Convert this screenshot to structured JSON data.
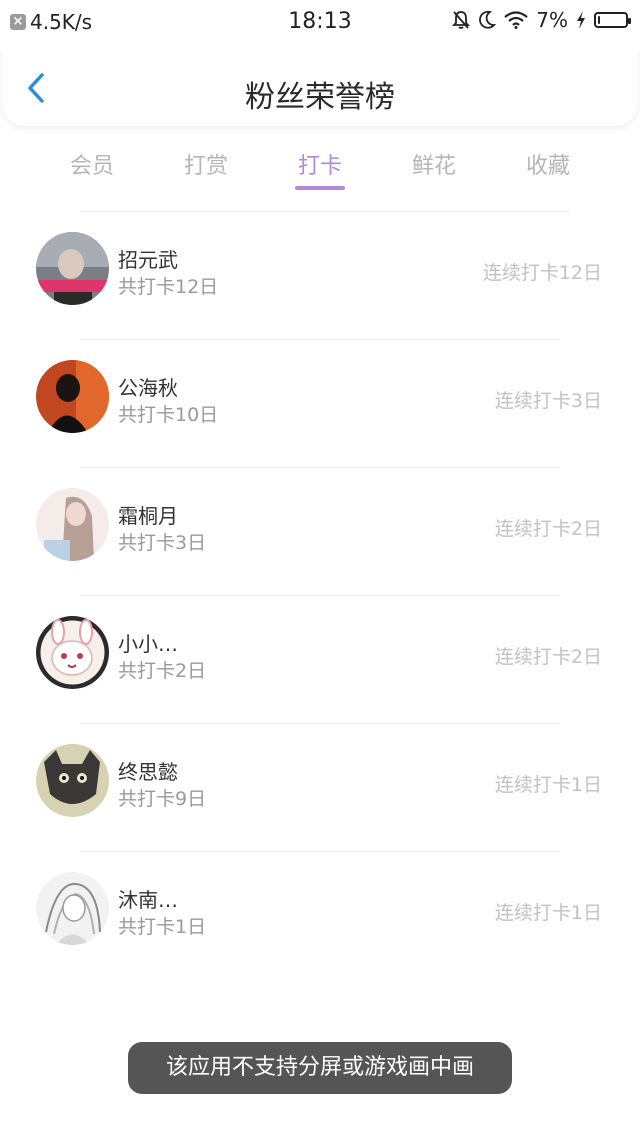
{
  "status_bar": {
    "speed": "4.5K/s",
    "time": "18:13",
    "battery": "7%",
    "battery_level": 0.07,
    "icons": [
      "notification-off-icon",
      "moon-icon",
      "wifi-icon",
      "charging-icon",
      "battery-icon"
    ]
  },
  "nav": {
    "title": "粉丝荣誉榜",
    "back_icon": "chevron-left-icon"
  },
  "tabs": [
    {
      "label": "会员",
      "active": false
    },
    {
      "label": "打赏",
      "active": false
    },
    {
      "label": "打卡",
      "active": true
    },
    {
      "label": "鲜花",
      "active": false
    },
    {
      "label": "收藏",
      "active": false
    }
  ],
  "fans": [
    {
      "name": "招元武",
      "total": "共打卡12日",
      "streak": "连续打卡12日"
    },
    {
      "name": "公海秋",
      "total": "共打卡10日",
      "streak": "连续打卡3日"
    },
    {
      "name": "霜桐月",
      "total": "共打卡3日",
      "streak": "连续打卡2日"
    },
    {
      "name": "小小…",
      "total": "共打卡2日",
      "streak": "连续打卡2日"
    },
    {
      "name": "终思懿",
      "total": "共打卡9日",
      "streak": "连续打卡1日"
    },
    {
      "name": "沐南…",
      "total": "共打卡1日",
      "streak": "连续打卡1日"
    }
  ],
  "toast": "该应用不支持分屏或游戏画中画",
  "colors": {
    "accent": "#b28ad9",
    "back": "#2b8fd8",
    "toast_bg": "#555555"
  }
}
